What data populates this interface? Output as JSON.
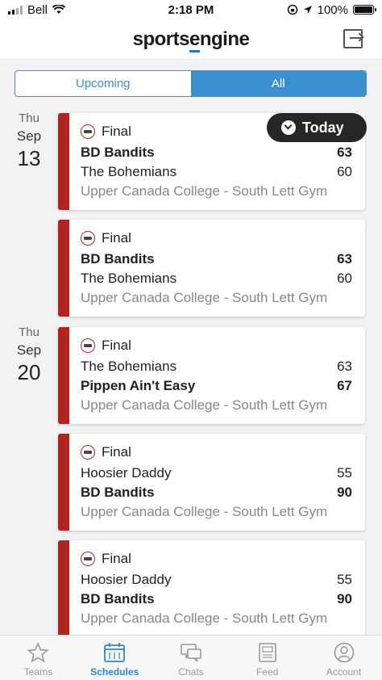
{
  "status_bar": {
    "carrier": "Bell",
    "time": "2:18 PM",
    "battery": "100%"
  },
  "header": {
    "logo_main": "sports",
    "logo_accent": "e",
    "logo_end": "ngine"
  },
  "segmented": {
    "upcoming": "Upcoming",
    "all": "All",
    "selected": "All"
  },
  "today_button": {
    "label": "Today"
  },
  "dates": [
    {
      "dow": "Thu",
      "month": "Sep",
      "day": "13"
    },
    {
      "dow": "Thu",
      "month": "Sep",
      "day": "20"
    }
  ],
  "games": [
    {
      "status": "Final",
      "team1": "BD Bandits",
      "score1": "63",
      "team2": "The Bohemians",
      "score2": "60",
      "winner": 1,
      "venue": "Upper Canada College - South Lett Gym"
    },
    {
      "status": "Final",
      "team1": "BD Bandits",
      "score1": "63",
      "team2": "The Bohemians",
      "score2": "60",
      "winner": 1,
      "venue": "Upper Canada College - South Lett Gym"
    },
    {
      "status": "Final",
      "team1": "The Bohemians",
      "score1": "63",
      "team2": "Pippen Ain't Easy",
      "score2": "67",
      "winner": 2,
      "venue": "Upper Canada College - South Lett Gym"
    },
    {
      "status": "Final",
      "team1": "Hoosier Daddy",
      "score1": "55",
      "team2": "BD Bandits",
      "score2": "90",
      "winner": 2,
      "venue": "Upper Canada College - South Lett Gym"
    },
    {
      "status": "Final",
      "team1": "Hoosier Daddy",
      "score1": "55",
      "team2": "BD Bandits",
      "score2": "90",
      "winner": 2,
      "venue": "Upper Canada College - South Lett Gym"
    }
  ],
  "tabs": [
    {
      "label": "Teams",
      "icon": "star-icon",
      "active": false
    },
    {
      "label": "Schedules",
      "icon": "calendar-icon",
      "active": true
    },
    {
      "label": "Chats",
      "icon": "chat-icon",
      "active": false
    },
    {
      "label": "Feed",
      "icon": "feed-icon",
      "active": false
    },
    {
      "label": "Account",
      "icon": "account-icon",
      "active": false
    }
  ],
  "colors": {
    "accent": "#3a8fd0",
    "card_bar": "#b3231f",
    "active_tab": "#2a86cf"
  }
}
